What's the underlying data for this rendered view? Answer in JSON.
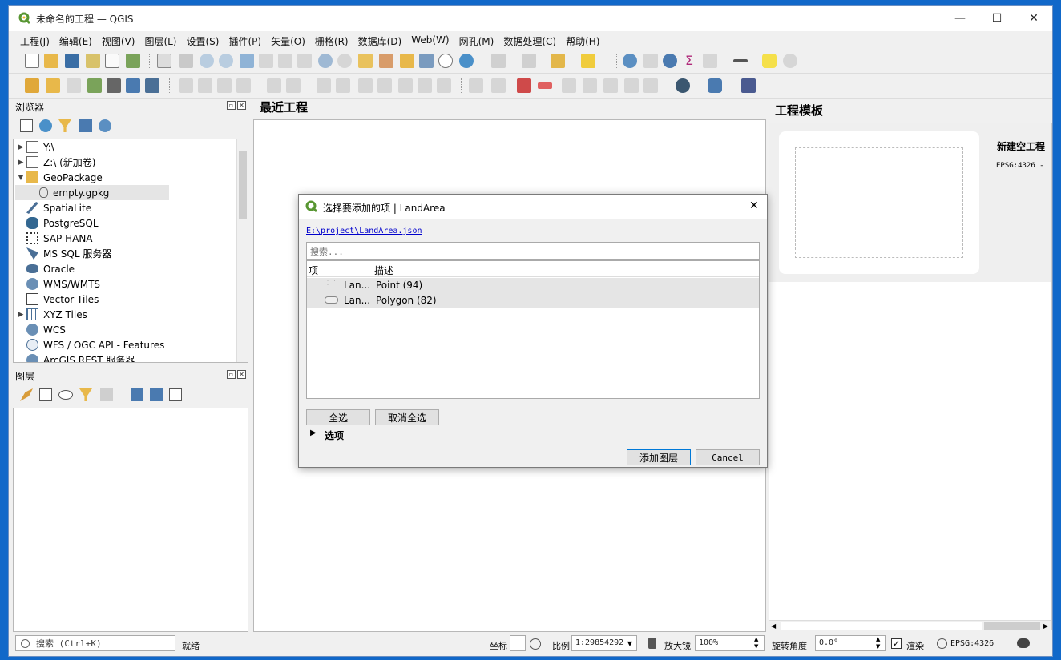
{
  "window": {
    "title": "未命名的工程 — QGIS",
    "min": "—",
    "max": "☐",
    "close": "✕"
  },
  "menu": [
    "工程(J)",
    "编辑(E)",
    "视图(V)",
    "图层(L)",
    "设置(S)",
    "插件(P)",
    "矢量(O)",
    "栅格(R)",
    "数据库(D)",
    "Web(W)",
    "网孔(M)",
    "数据处理(C)",
    "帮助(H)"
  ],
  "browser": {
    "title": "浏览器",
    "items": [
      {
        "label": "Y:\\",
        "arrow": "▶",
        "icon": "folder-icon"
      },
      {
        "label": "Z:\\ (新加卷)",
        "arrow": "▶",
        "icon": "folder-icon"
      },
      {
        "label": "GeoPackage",
        "arrow": "▼",
        "icon": "geopackage-icon"
      },
      {
        "label": "empty.gpkg",
        "arrow": "",
        "icon": "database-icon"
      },
      {
        "label": "SpatiaLite",
        "arrow": "",
        "icon": "feather-icon"
      },
      {
        "label": "PostgreSQL",
        "arrow": "",
        "icon": "elephant-icon"
      },
      {
        "label": "SAP HANA",
        "arrow": "",
        "icon": "hana-icon"
      },
      {
        "label": "MS SQL 服务器",
        "arrow": "",
        "icon": "mssql-icon"
      },
      {
        "label": "Oracle",
        "arrow": "",
        "icon": "oracle-icon"
      },
      {
        "label": "WMS/WMTS",
        "arrow": "",
        "icon": "globe-icon"
      },
      {
        "label": "Vector Tiles",
        "arrow": "",
        "icon": "grid-icon"
      },
      {
        "label": "XYZ Tiles",
        "arrow": "▶",
        "icon": "grid-icon"
      },
      {
        "label": "WCS",
        "arrow": "",
        "icon": "globe-icon"
      },
      {
        "label": "WFS / OGC API - Features",
        "arrow": "",
        "icon": "wfs-icon"
      },
      {
        "label": "ArcGIS REST 服务器",
        "arrow": "",
        "icon": "globe-icon"
      }
    ]
  },
  "layers": {
    "title": "图层"
  },
  "recent": {
    "title": "最近工程"
  },
  "templates": {
    "title": "工程模板",
    "new_project": "新建空工程",
    "crs": "EPSG:4326 -"
  },
  "dialog": {
    "title": "选择要添加的项 | LandArea",
    "path": "E:\\project\\LandArea.json",
    "search_placeholder": "搜索...",
    "col_item": "项",
    "col_desc": "描述",
    "rows": [
      {
        "item": "Lan...",
        "desc": "Point (94)",
        "icon": "point-icon"
      },
      {
        "item": "Lan...",
        "desc": "Polygon (82)",
        "icon": "polygon-icon"
      }
    ],
    "select_all": "全选",
    "deselect_all": "取消全选",
    "options": "选项",
    "add_layers": "添加图层",
    "cancel": "Cancel"
  },
  "status": {
    "search_placeholder": "搜索 (Ctrl+K)",
    "ready": "就绪",
    "coord_label": "坐标",
    "scale_label": "比例",
    "scale_value": "1:29854292",
    "magnifier_label": "放大镜",
    "magnifier_value": "100%",
    "rotation_label": "旋转角度",
    "rotation_value": "0.0°",
    "render_label": "渲染",
    "crs": "EPSG:4326"
  }
}
